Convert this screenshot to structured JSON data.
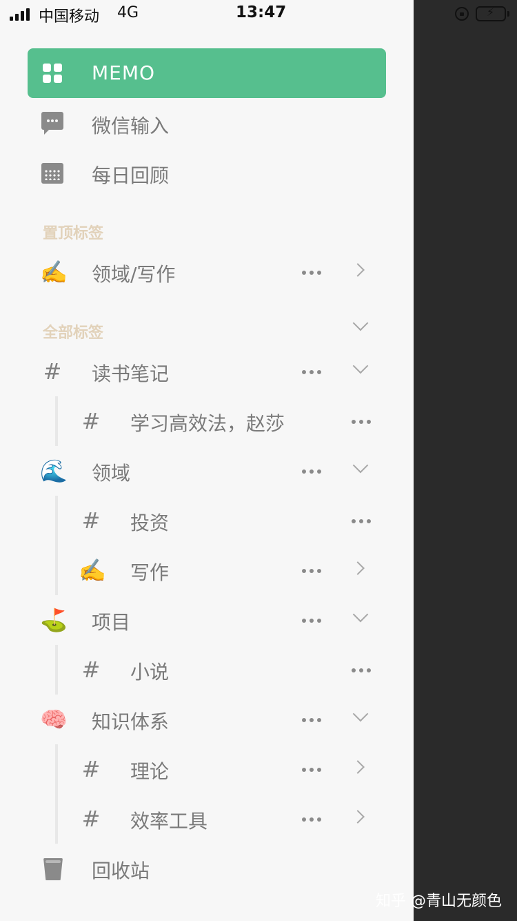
{
  "status": {
    "carrier": "中国移动",
    "network": "4G",
    "time": "13:47"
  },
  "menu": {
    "memo": "MEMO",
    "wechat": "微信输入",
    "daily": "每日回顾",
    "trash": "回收站"
  },
  "pinned": {
    "header": "置顶标签",
    "items": [
      {
        "emoji": "✍️",
        "label": "领域/写作"
      }
    ]
  },
  "all_tags": {
    "header": "全部标签",
    "groups": [
      {
        "icon": "#",
        "label": "读书笔记",
        "children": [
          {
            "icon": "#",
            "label": "学习高效法，赵莎"
          }
        ]
      },
      {
        "icon": "🌊",
        "label": "领域",
        "children": [
          {
            "icon": "#",
            "label": "投资"
          },
          {
            "icon": "✍️",
            "label": "写作"
          }
        ]
      },
      {
        "icon": "⛳",
        "label": "项目",
        "children": [
          {
            "icon": "#",
            "label": "小说"
          }
        ]
      },
      {
        "icon": "🧠",
        "label": "知识体系",
        "children": [
          {
            "icon": "#",
            "label": "理论"
          },
          {
            "icon": "#",
            "label": "效率工具"
          }
        ]
      }
    ]
  },
  "watermark": "知乎 @青山无颜色",
  "colors": {
    "accent": "#56bf8e",
    "section": "#e2d2ba",
    "drawer": "#f7f7f7",
    "overlay": "#2a2a2a"
  }
}
